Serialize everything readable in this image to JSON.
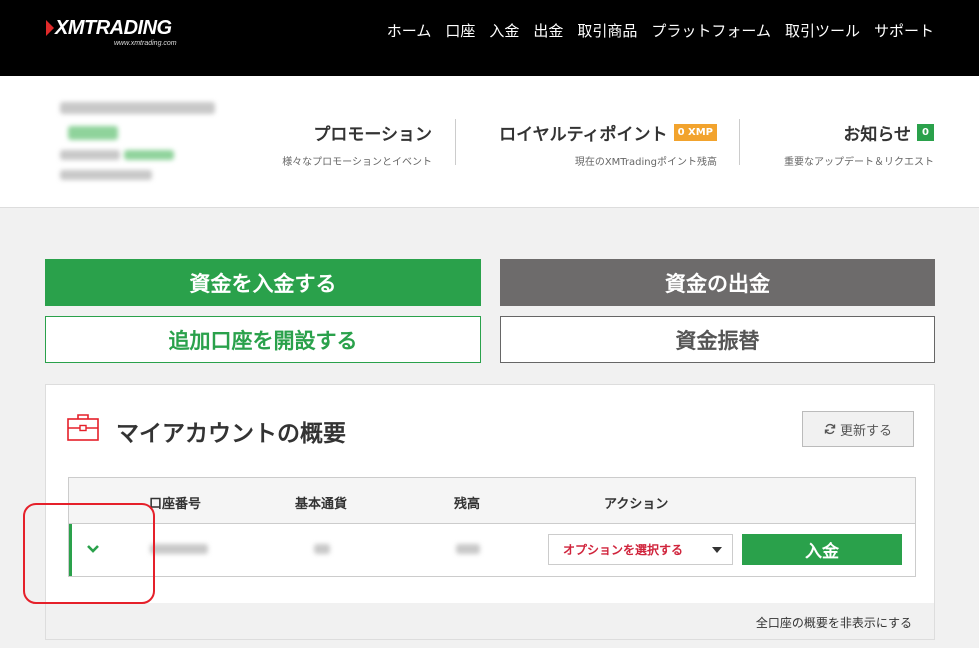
{
  "brand": {
    "name": "XMTRADING",
    "url": "www.xmtrading.com",
    "accent": "#e02a2a"
  },
  "nav": {
    "items": [
      "ホーム",
      "口座",
      "入金",
      "出金",
      "取引商品",
      "プラットフォーム",
      "取引ツール",
      "サポート"
    ]
  },
  "info": {
    "promo": {
      "title": "プロモーション",
      "sub": "様々なプロモーションとイベント"
    },
    "loyalty": {
      "title": "ロイヤルティポイント",
      "badge": "0 XMP",
      "sub": "現在のXMTradingポイント残高"
    },
    "news": {
      "title": "お知らせ",
      "badge": "0",
      "sub": "重要なアップデート＆リクエスト"
    }
  },
  "actions": {
    "deposit": "資金を入金する",
    "withdraw": "資金の出金",
    "open_account": "追加口座を開設する",
    "transfer": "資金振替"
  },
  "panel": {
    "title": "マイアカウントの概要",
    "refresh": "更新する",
    "columns": {
      "account": "口座番号",
      "currency": "基本通貨",
      "balance": "残高",
      "action": "アクション"
    },
    "row": {
      "select_placeholder": "オプションを選択する",
      "deposit": "入金"
    },
    "hide_all": "全口座の概要を非表示にする"
  },
  "colors": {
    "green": "#2aa14b",
    "gray": "#6d6b6b",
    "red": "#d0243c",
    "orange": "#f2a32d"
  }
}
